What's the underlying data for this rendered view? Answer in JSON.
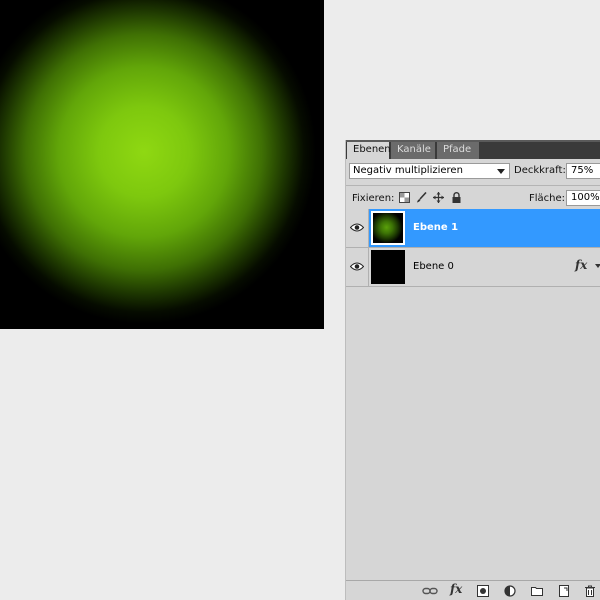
{
  "tabs": [
    {
      "label": "Ebenen",
      "active": true
    },
    {
      "label": "Kanäle",
      "active": false
    },
    {
      "label": "Pfade",
      "active": false
    }
  ],
  "blend_mode": "Negativ multiplizieren",
  "opacity": {
    "label": "Deckkraft:",
    "value": "75%"
  },
  "lock": {
    "label": "Fixieren:"
  },
  "fill": {
    "label": "Fläche:",
    "value": "100%"
  },
  "layers": [
    {
      "name": "Ebene 1",
      "selected": true,
      "visible": true
    },
    {
      "name": "Ebene 0",
      "selected": false,
      "visible": true,
      "has_fx": true
    }
  ],
  "fx_label": "fx",
  "colors": {
    "selection": "#3399ff",
    "gradient_center": "#8fd812"
  }
}
